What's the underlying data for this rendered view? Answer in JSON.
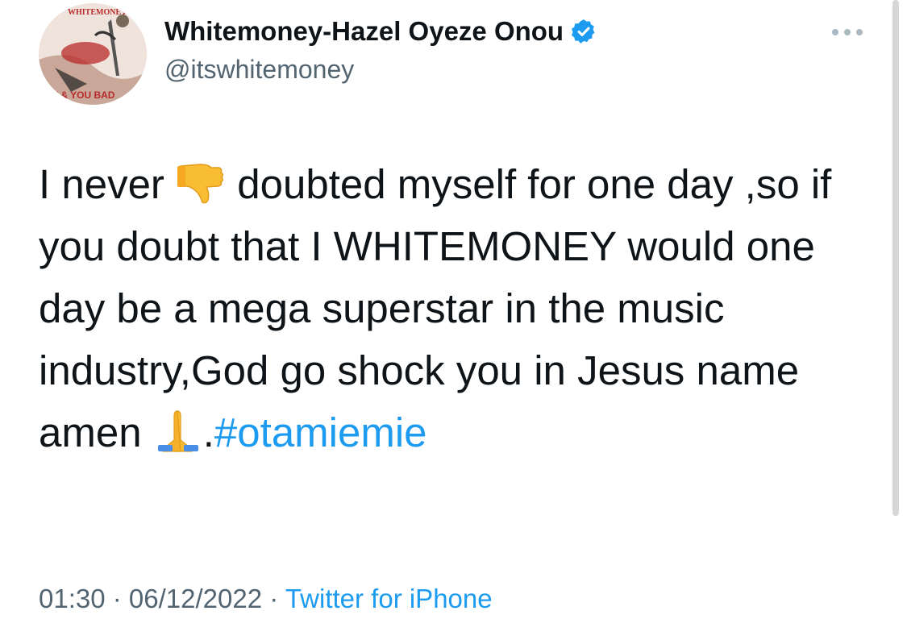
{
  "user": {
    "display_name": "Whitemoney-Hazel Oyeze Onou",
    "handle": "@itswhitemoney",
    "verified": true,
    "avatar_text_top": "WHITEMONEY",
    "avatar_text_bottom": "WU & YOU BAD"
  },
  "tweet": {
    "segments": [
      {
        "type": "text",
        "value": "I never "
      },
      {
        "type": "emoji",
        "name": "thumbs-down-emoji"
      },
      {
        "type": "text",
        "value": " doubted myself for one day ,so if you doubt that I WHITEMONEY would one day be a mega superstar in the music industry,God go shock you in Jesus name amen "
      },
      {
        "type": "emoji",
        "name": "folded-hands-emoji"
      },
      {
        "type": "text",
        "value": "."
      },
      {
        "type": "hashtag",
        "value": "#otamiemie"
      }
    ]
  },
  "meta": {
    "time": "01:30",
    "sep1": " · ",
    "date": "06/12/2022",
    "sep2": " · ",
    "source": "Twitter for iPhone"
  },
  "icons": {
    "verified": "verified-badge-icon",
    "more": "more-options-icon"
  },
  "colors": {
    "accent": "#1d9bf0",
    "text": "#0f1419",
    "secondary": "#536471"
  }
}
